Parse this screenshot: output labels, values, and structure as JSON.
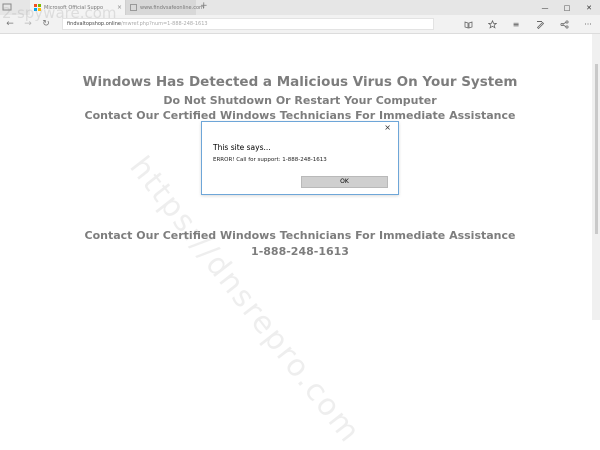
{
  "browser": {
    "tabs": [
      {
        "title": "Microsoft Official Suppo",
        "close": "×"
      },
      {
        "title": "www.findvsafeonline.com"
      }
    ],
    "new_tab_label": "+",
    "window_controls": {
      "minimize": "—",
      "maximize": "□",
      "close": "✕"
    },
    "address": {
      "host": "findvaltopshop.online",
      "path": "/mwref.php?num=1-888-248-1613"
    },
    "nav": {
      "back": "←",
      "forward": "→",
      "refresh": "↻"
    },
    "toolbar_icons": [
      "reading-view-icon",
      "favorite-star-icon",
      "hub-icon",
      "notes-icon",
      "share-icon",
      "more-icon"
    ],
    "toolbar_glyphs": {
      "hub": "≡",
      "more": "···"
    }
  },
  "page": {
    "headline_1": "Windows Has Detected a Malicious Virus On Your System",
    "headline_2": "Do Not Shutdown Or Restart Your Computer",
    "headline_3": "Contact Our Certified Windows Technicians For Immediate Assistance",
    "headline_4": "Contact Our Certified Windows Technicians For Immediate Assistance",
    "phone": "1-888-248-1613"
  },
  "dialog": {
    "title": "This site says...",
    "message": "ERROR! Call for support: 1-888-248-1613",
    "ok_label": "OK",
    "close_label": "×"
  },
  "watermark": {
    "text": "https://dnsrepro.com",
    "corner": "2-spyware.com"
  },
  "colors": {
    "headline": "#7d7d7d",
    "dialog_border": "#6ea6d8",
    "ok_button": "#cfcfcf"
  }
}
